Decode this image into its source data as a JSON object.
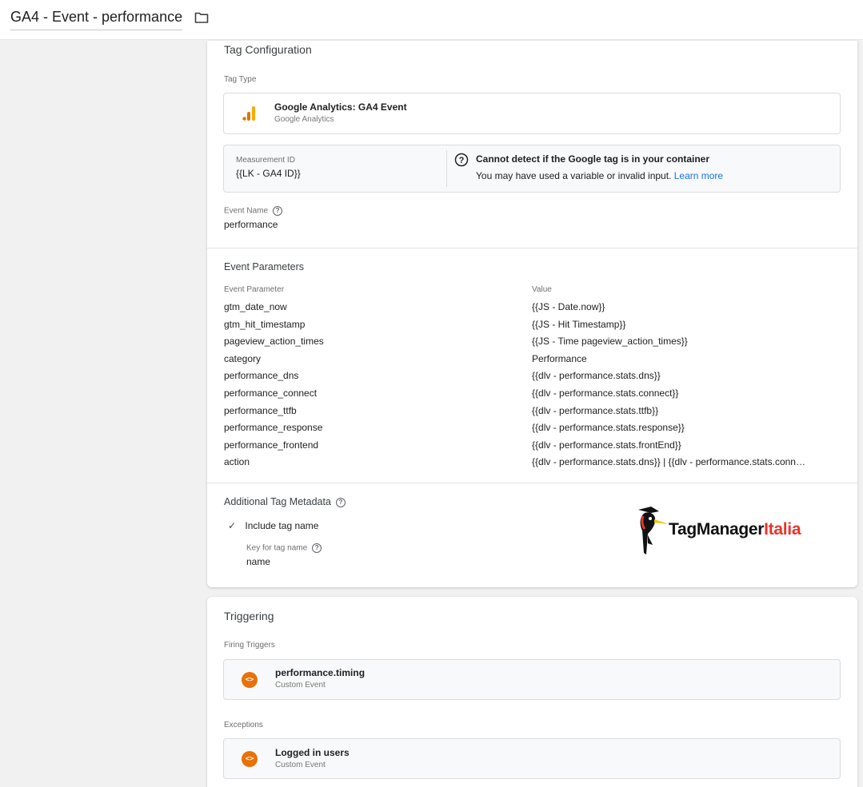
{
  "header": {
    "tag_name": "GA4 - Event - performance",
    "folder_icon": "folder-icon"
  },
  "config": {
    "section_title": "Tag Configuration",
    "tag_type_label": "Tag Type",
    "tag_type_name": "Google Analytics: GA4 Event",
    "tag_type_sub": "Google Analytics",
    "measurement_id_label": "Measurement ID",
    "measurement_id_value": "{{LK - GA4 ID}}",
    "warning_title": "Cannot detect if the Google tag is in your container",
    "warning_text": "You may have used a variable or invalid input.",
    "warning_link": "Learn more",
    "event_name_label": "Event Name",
    "event_name_value": "performance"
  },
  "params": {
    "section_title": "Event Parameters",
    "col_param": "Event Parameter",
    "col_value": "Value",
    "rows": [
      {
        "name": "gtm_date_now",
        "value": "{{JS - Date.now}}"
      },
      {
        "name": "gtm_hit_timestamp",
        "value": "{{JS - Hit Timestamp}}"
      },
      {
        "name": "pageview_action_times",
        "value": "{{JS - Time pageview_action_times}}"
      },
      {
        "name": "category",
        "value": "Performance"
      },
      {
        "name": "performance_dns",
        "value": "{{dlv - performance.stats.dns}}"
      },
      {
        "name": "performance_connect",
        "value": "{{dlv - performance.stats.connect}}"
      },
      {
        "name": "performance_ttfb",
        "value": "{{dlv - performance.stats.ttfb}}"
      },
      {
        "name": "performance_response",
        "value": "{{dlv - performance.stats.response}}"
      },
      {
        "name": "performance_frontend",
        "value": "{{dlv - performance.stats.frontEnd}}"
      },
      {
        "name": "action",
        "value": "{{dlv - performance.stats.dns}} | {{dlv - performance.stats.conn…"
      }
    ]
  },
  "metadata": {
    "section_title": "Additional Tag Metadata",
    "include_label": "Include tag name",
    "key_label": "Key for tag name",
    "key_value": "name"
  },
  "watermark": {
    "brand_a": "TagManager",
    "brand_b": "Italia"
  },
  "triggering": {
    "section_title": "Triggering",
    "firing_label": "Firing Triggers",
    "firing": {
      "name": "performance.timing",
      "type": "Custom Event"
    },
    "exceptions_label": "Exceptions",
    "exception": {
      "name": "Logged in users",
      "type": "Custom Event"
    }
  },
  "colors": {
    "accent_link": "#1a73e8",
    "trigger_orange": "#e8710a",
    "ga_orange": "#f9ab00",
    "brand_red": "#e8342c"
  }
}
